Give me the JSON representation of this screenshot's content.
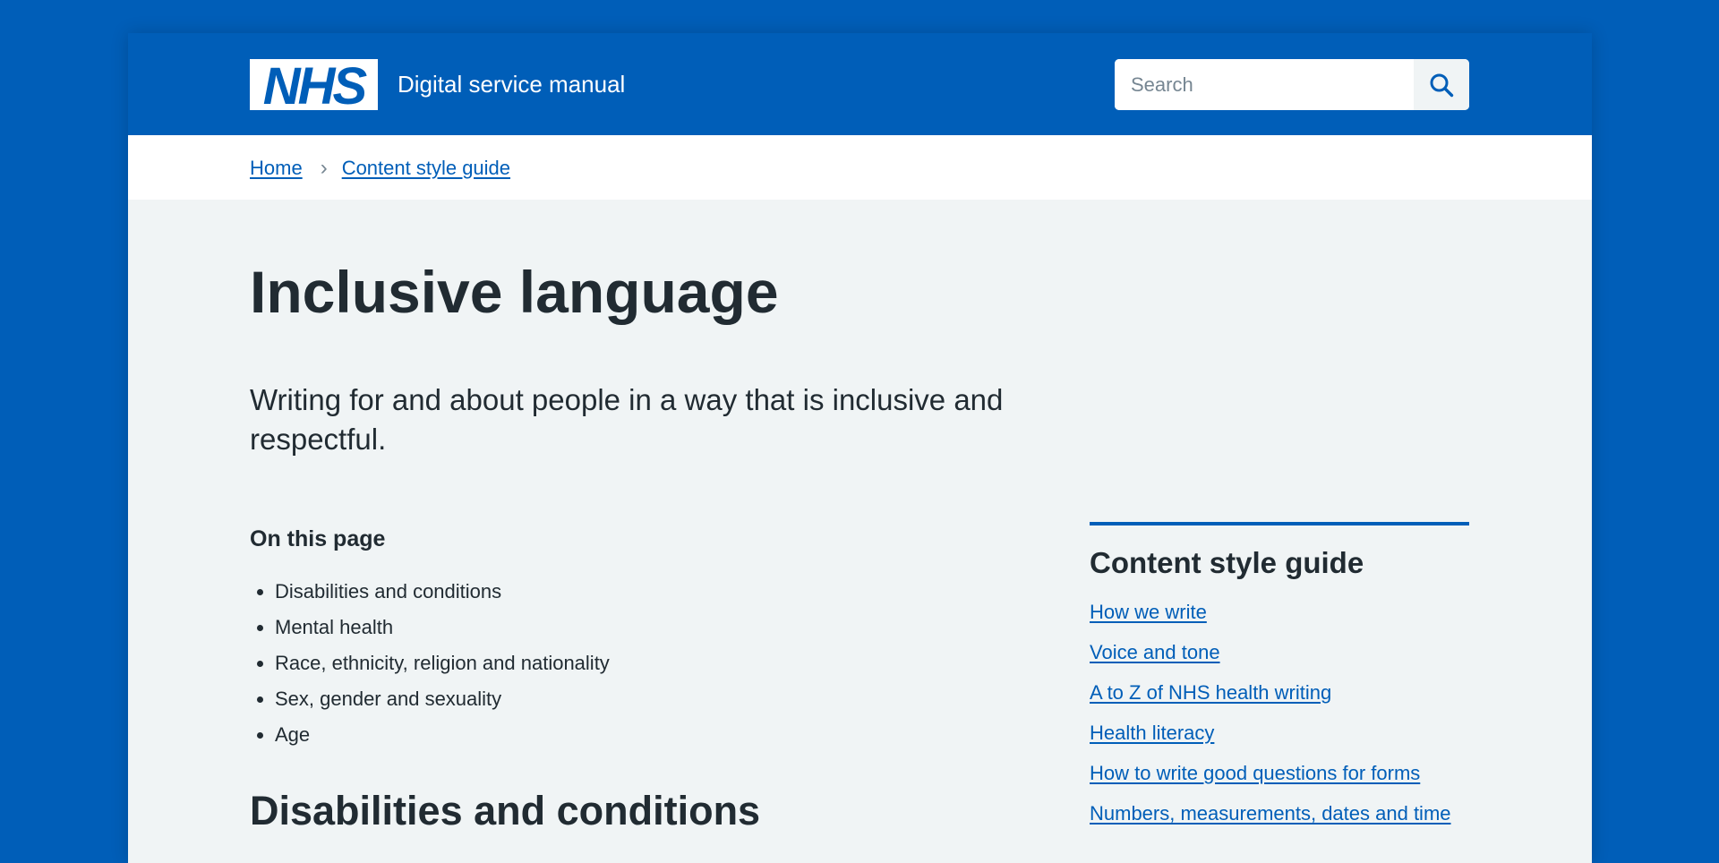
{
  "header": {
    "logo_text": "NHS",
    "service_name": "Digital service manual",
    "search": {
      "placeholder": "Search",
      "value": "",
      "button_icon": "search-icon"
    }
  },
  "breadcrumb": {
    "items": [
      "Home",
      "Content style guide"
    ],
    "separator_icon": "chevron-right-icon"
  },
  "main": {
    "title": "Inclusive language",
    "lede": "Writing for and about people in a way that is inclusive and respectful.",
    "on_this_page": {
      "heading": "On this page",
      "items": [
        "Disabilities and conditions",
        "Mental health",
        "Race, ethnicity, religion and nationality",
        "Sex, gender and sexuality",
        "Age"
      ]
    },
    "section_heading": "Disabilities and conditions"
  },
  "side_nav": {
    "title": "Content style guide",
    "links": [
      "How we write",
      "Voice and tone",
      "A to Z of NHS health writing",
      "Health literacy",
      "How to write good questions for forms",
      "Numbers, measurements, dates and time"
    ]
  },
  "colors": {
    "nhs_blue": "#005eb8",
    "text": "#212b32",
    "secondary_text": "#768692",
    "page_background": "#f0f4f5",
    "white": "#ffffff"
  }
}
